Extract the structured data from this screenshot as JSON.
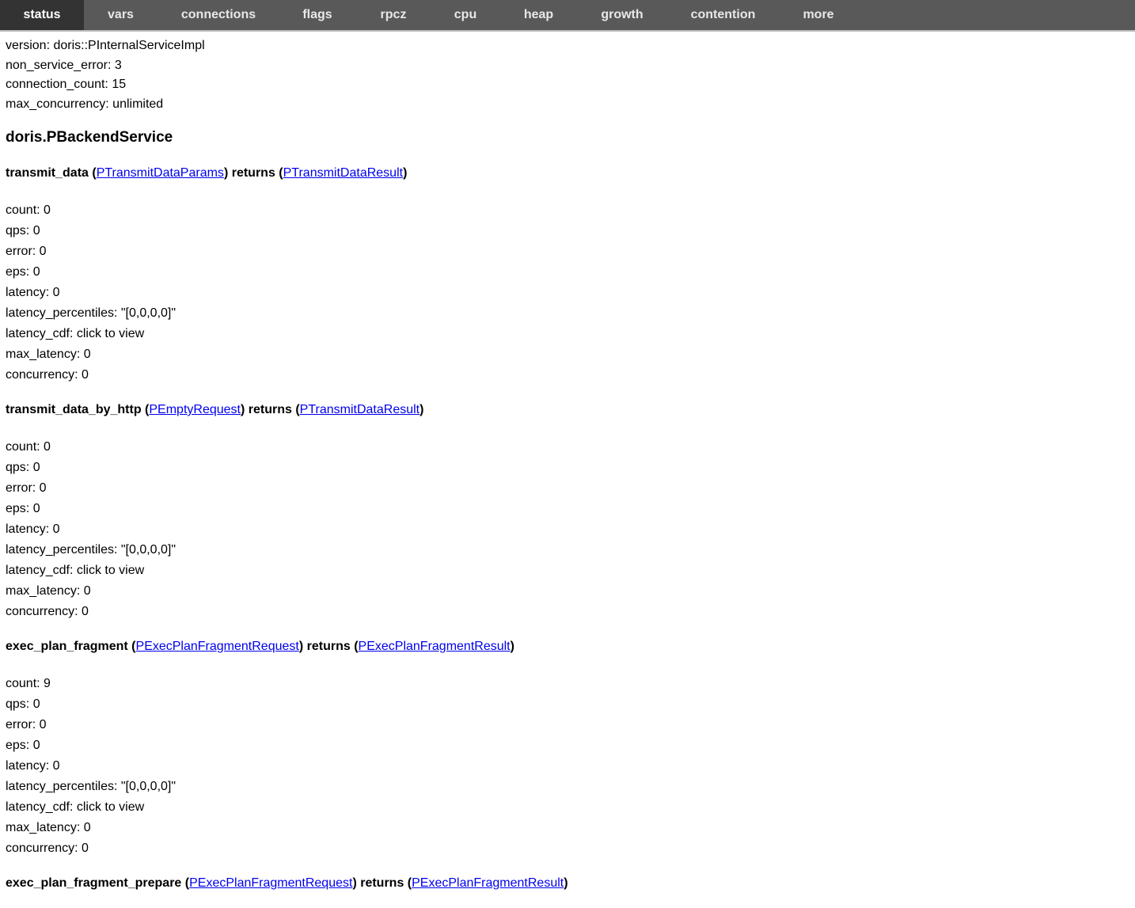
{
  "nav": {
    "tabs": [
      {
        "label": "status",
        "active": true
      },
      {
        "label": "vars",
        "active": false
      },
      {
        "label": "connections",
        "active": false
      },
      {
        "label": "flags",
        "active": false
      },
      {
        "label": "rpcz",
        "active": false
      },
      {
        "label": "cpu",
        "active": false
      },
      {
        "label": "heap",
        "active": false
      },
      {
        "label": "growth",
        "active": false
      },
      {
        "label": "contention",
        "active": false
      },
      {
        "label": "more",
        "active": false
      }
    ]
  },
  "server_info": [
    "version: doris::PInternalServiceImpl",
    "non_service_error: 3",
    "connection_count: 15",
    "max_concurrency: unlimited"
  ],
  "service": {
    "title": "doris.PBackendService",
    "methods": [
      {
        "name": "transmit_data",
        "request_type": "PTransmitDataParams",
        "returns_word": "returns",
        "response_type": "PTransmitDataResult",
        "stats": [
          "count: 0",
          "qps: 0",
          "error: 0",
          "eps: 0",
          "latency: 0",
          "latency_percentiles: \"[0,0,0,0]\"",
          "latency_cdf: click to view",
          "max_latency: 0",
          "concurrency: 0"
        ]
      },
      {
        "name": "transmit_data_by_http",
        "request_type": "PEmptyRequest",
        "returns_word": "returns",
        "response_type": "PTransmitDataResult",
        "stats": [
          "count: 0",
          "qps: 0",
          "error: 0",
          "eps: 0",
          "latency: 0",
          "latency_percentiles: \"[0,0,0,0]\"",
          "latency_cdf: click to view",
          "max_latency: 0",
          "concurrency: 0"
        ]
      },
      {
        "name": "exec_plan_fragment",
        "request_type": "PExecPlanFragmentRequest",
        "returns_word": "returns",
        "response_type": "PExecPlanFragmentResult",
        "stats": [
          "count: 9",
          "qps: 0",
          "error: 0",
          "eps: 0",
          "latency: 0",
          "latency_percentiles: \"[0,0,0,0]\"",
          "latency_cdf: click to view",
          "max_latency: 0",
          "concurrency: 0"
        ]
      },
      {
        "name": "exec_plan_fragment_prepare",
        "request_type": "PExecPlanFragmentRequest",
        "returns_word": "returns",
        "response_type": "PExecPlanFragmentResult",
        "stats": []
      }
    ]
  }
}
